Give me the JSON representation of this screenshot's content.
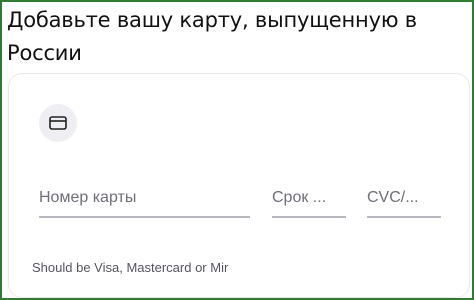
{
  "page": {
    "title": "Добавьте вашу карту, выпущенную в России",
    "border_color": "#2e7d32"
  },
  "form": {
    "card_icon": "credit-card-icon",
    "card_number_placeholder": "Номер карты",
    "expiry_placeholder": "Срок ...",
    "cvc_placeholder": "CVC/...",
    "hint": "Should be Visa, Mastercard or Mir"
  }
}
